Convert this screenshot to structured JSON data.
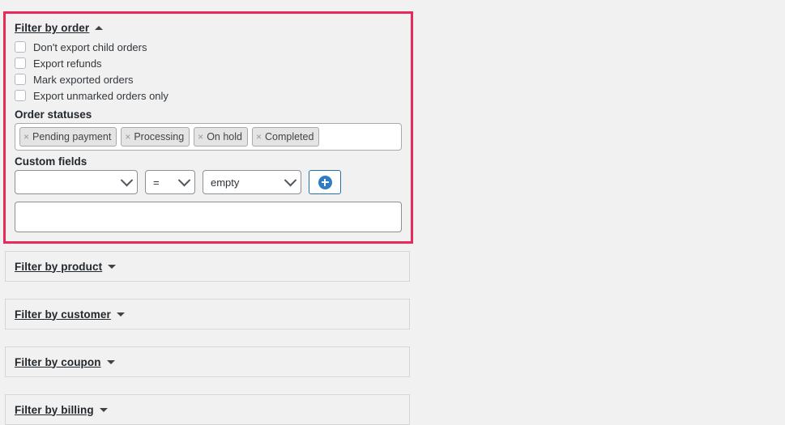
{
  "page": {
    "background_color": "#f1f1f1",
    "highlight_color": "#e8295a"
  },
  "order_panel": {
    "title": "Filter by order",
    "caret_icon": "chevron-up-icon",
    "expanded": true,
    "checkboxes": [
      {
        "label": "Don't export child orders",
        "checked": false
      },
      {
        "label": "Export refunds",
        "checked": false
      },
      {
        "label": "Mark exported orders",
        "checked": false
      },
      {
        "label": "Export unmarked orders only",
        "checked": false
      }
    ],
    "order_statuses": {
      "label": "Order statuses",
      "remove_glyph": "×",
      "tags": [
        {
          "label": "Pending payment"
        },
        {
          "label": "Processing"
        },
        {
          "label": "On hold"
        },
        {
          "label": "Completed"
        }
      ]
    },
    "custom_fields": {
      "label": "Custom fields",
      "key_select": {
        "value": "",
        "placeholder": ""
      },
      "operator_select": {
        "value": "="
      },
      "value_select": {
        "value": "empty"
      },
      "add_button": {
        "icon": "plus-circle-icon"
      },
      "free_text": {
        "value": "",
        "placeholder": ""
      }
    }
  },
  "collapsed_panels": [
    {
      "title": "Filter by product",
      "caret_icon": "chevron-down-icon"
    },
    {
      "title": "Filter by customer",
      "caret_icon": "chevron-down-icon"
    },
    {
      "title": "Filter by coupon",
      "caret_icon": "chevron-down-icon"
    },
    {
      "title": "Filter by billing",
      "caret_icon": "chevron-down-icon"
    }
  ]
}
